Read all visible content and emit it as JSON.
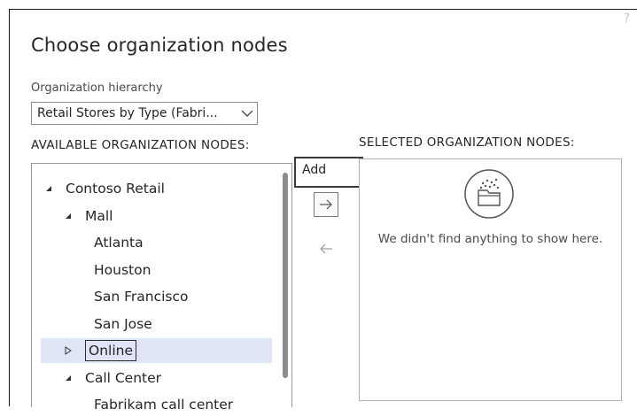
{
  "dialog": {
    "title": "Choose organization nodes",
    "corner_glyph": "?"
  },
  "hierarchy_field": {
    "label": "Organization hierarchy",
    "value": "Retail Stores by Type (Fabri..."
  },
  "available": {
    "header": "AVAILABLE ORGANIZATION NODES:",
    "nodes": [
      {
        "label": "Contoso Retail",
        "level": 0,
        "toggle": "expanded"
      },
      {
        "label": "Mall",
        "level": 1,
        "toggle": "expanded"
      },
      {
        "label": "Atlanta",
        "level": 2,
        "toggle": "none"
      },
      {
        "label": "Houston",
        "level": 2,
        "toggle": "none"
      },
      {
        "label": "San Francisco",
        "level": 2,
        "toggle": "none"
      },
      {
        "label": "San Jose",
        "level": 2,
        "toggle": "none"
      },
      {
        "label": "Online",
        "level": 1,
        "toggle": "collapsed",
        "selected": true
      },
      {
        "label": "Call Center",
        "level": 1,
        "toggle": "expanded"
      },
      {
        "label": "Fabrikam call center",
        "level": 2,
        "toggle": "none"
      }
    ]
  },
  "transfer": {
    "add_tooltip": "Add",
    "add_icon": "arrow-right-icon",
    "remove_icon": "arrow-left-icon"
  },
  "selected": {
    "header": "SELECTED ORGANIZATION NODES:",
    "empty_message": "We didn't find anything to show here.",
    "empty_icon": "empty-folder-icon"
  },
  "colors": {
    "selection": "#dfe4f7",
    "border": "#9a9a9a"
  }
}
